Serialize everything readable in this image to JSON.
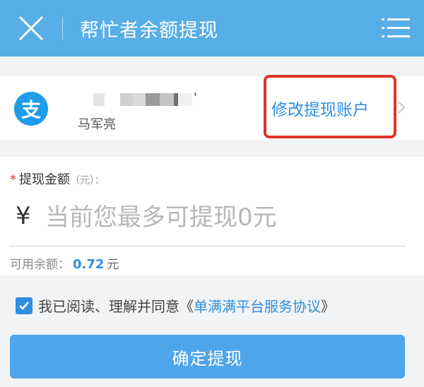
{
  "header": {
    "title": "帮忙者余额提现",
    "bg_color": "#58aee6",
    "close_icon": "close-icon",
    "menu_icon": "menu-icon"
  },
  "account": {
    "icon_glyph": "支",
    "icon": "alipay-icon",
    "masked_suffix": "'",
    "holder_name": "马军亮",
    "modify_label": "修改提现账户",
    "highlight_color": "#e0352a"
  },
  "amount": {
    "required_mark": "*",
    "label": "提现金额",
    "unit_hint": "（元）：",
    "currency_symbol": "¥",
    "placeholder": "当前您最多可提现0元",
    "balance_label": "可用余额：",
    "balance_value": "0.72",
    "balance_unit": "元"
  },
  "agreement": {
    "checked": true,
    "text_prefix": "我已阅读、理解并同意《",
    "link_text": "单满满平台服务协议",
    "text_suffix": "》"
  },
  "confirm": {
    "label": "确定提现",
    "color": "#4ea5ea"
  }
}
